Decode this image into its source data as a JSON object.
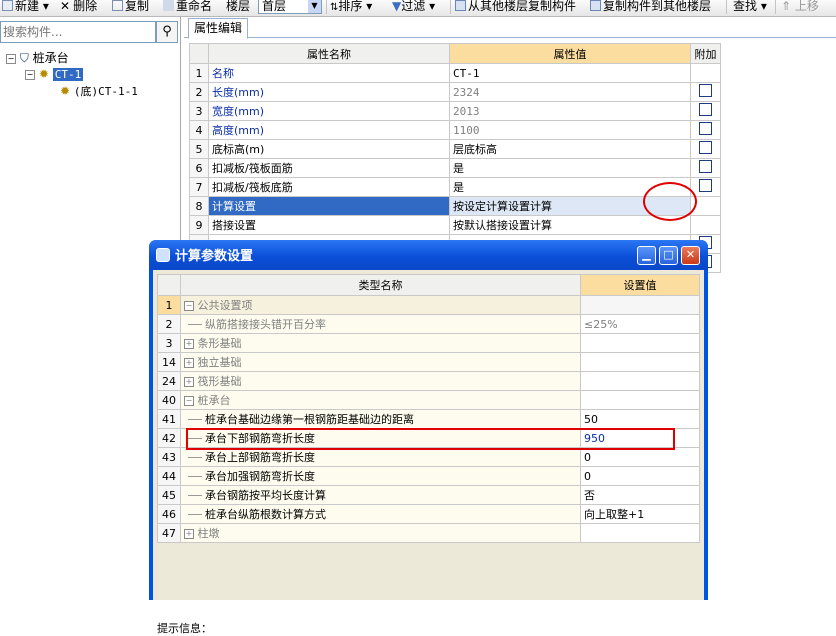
{
  "toolbar": {
    "new_label": "新建",
    "delete_label": "删除",
    "copy_label": "复制",
    "rename_label": "重命名",
    "floor_label": "楼层",
    "floor_value": "首层",
    "sort_label": "排序",
    "filter_label": "过滤",
    "copy_from_floor_label": "从其他楼层复制构件",
    "copy_to_floor_label": "复制构件到其他楼层",
    "find_label": "查找",
    "move_up_label": "上移"
  },
  "left": {
    "search_placeholder": "搜索构件...",
    "tree": [
      {
        "label": "桩承台"
      },
      {
        "label": "CT-1"
      },
      {
        "label": "(底)CT-1-1"
      }
    ]
  },
  "property_panel": {
    "tab_label": "属性编辑",
    "columns": [
      "属性名称",
      "属性值",
      "附加"
    ],
    "rows": [
      {
        "no": "1",
        "name": "名称",
        "value": "CT-1"
      },
      {
        "no": "2",
        "name": "长度(mm)",
        "value": "2324"
      },
      {
        "no": "3",
        "name": "宽度(mm)",
        "value": "2013"
      },
      {
        "no": "4",
        "name": "高度(mm)",
        "value": "1100"
      },
      {
        "no": "5",
        "name": "底标高(m)",
        "value": "层底标高"
      },
      {
        "no": "6",
        "name": "扣减板/筏板面筋",
        "value": "是"
      },
      {
        "no": "7",
        "name": "扣减板/筏板底筋",
        "value": "是"
      },
      {
        "no": "8",
        "name": "计算设置",
        "value": "按设定计算设置计算"
      },
      {
        "no": "9",
        "name": "搭接设置",
        "value": "按默认搭接设置计算"
      }
    ]
  },
  "dialog": {
    "title": "计算参数设置",
    "columns": [
      "类型名称",
      "设置值"
    ],
    "rows": [
      {
        "no": "1",
        "name": "公共设置项",
        "value": "",
        "kind": "group-open"
      },
      {
        "no": "2",
        "name": "纵筋搭接接头错开百分率",
        "value": "≤25%",
        "kind": "child-grey"
      },
      {
        "no": "3",
        "name": "条形基础",
        "value": "",
        "kind": "group-closed"
      },
      {
        "no": "14",
        "name": "独立基础",
        "value": "",
        "kind": "group-closed"
      },
      {
        "no": "24",
        "name": "筏形基础",
        "value": "",
        "kind": "group-closed"
      },
      {
        "no": "40",
        "name": "桩承台",
        "value": "",
        "kind": "group-open"
      },
      {
        "no": "41",
        "name": "桩承台基础边缘第一根钢筋距基础边的距离",
        "value": "50",
        "kind": "child"
      },
      {
        "no": "42",
        "name": "承台下部钢筋弯折长度",
        "value": "950",
        "kind": "child-selected"
      },
      {
        "no": "43",
        "name": "承台上部钢筋弯折长度",
        "value": "0",
        "kind": "child"
      },
      {
        "no": "44",
        "name": "承台加强钢筋弯折长度",
        "value": "0",
        "kind": "child"
      },
      {
        "no": "45",
        "name": "承台钢筋按平均长度计算",
        "value": "否",
        "kind": "child"
      },
      {
        "no": "46",
        "name": "桩承台纵筋根数计算方式",
        "value": "向上取整+1",
        "kind": "child"
      },
      {
        "no": "47",
        "name": "柱墩",
        "value": "",
        "kind": "group-closed"
      }
    ],
    "hint_label": "提示信息："
  }
}
